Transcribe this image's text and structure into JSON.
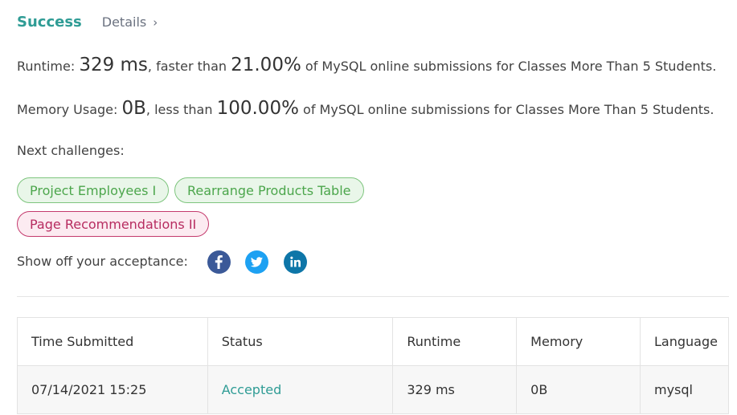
{
  "header": {
    "status": "Success",
    "details_label": "Details",
    "chevron": "›"
  },
  "runtime": {
    "label": "Runtime:",
    "value": "329 ms",
    "mid": ", faster than",
    "percent": "21.00%",
    "suffix": "of MySQL online submissions for Classes More Than 5 Students."
  },
  "memory": {
    "label": "Memory Usage:",
    "value": "0B",
    "mid": ", less than",
    "percent": "100.00%",
    "suffix": "of MySQL online submissions for Classes More Than 5 Students."
  },
  "next": {
    "label": "Next challenges:",
    "challenges": [
      {
        "title": "Project Employees I",
        "difficulty": "easy"
      },
      {
        "title": "Rearrange Products Table",
        "difficulty": "easy"
      },
      {
        "title": "Page Recommendations II",
        "difficulty": "hard"
      }
    ]
  },
  "share": {
    "label": "Show off your acceptance:",
    "icons": [
      "facebook-icon",
      "twitter-icon",
      "linkedin-icon"
    ]
  },
  "table": {
    "headers": [
      "Time Submitted",
      "Status",
      "Runtime",
      "Memory",
      "Language"
    ],
    "rows": [
      {
        "time": "07/14/2021 15:25",
        "status": "Accepted",
        "runtime": "329 ms",
        "memory": "0B",
        "language": "mysql"
      }
    ]
  },
  "colors": {
    "accent": "#2f9c95",
    "easy_border": "#7ec57e",
    "hard_border": "#c43a6d",
    "facebook": "#3b5998",
    "twitter": "#1da1f2",
    "linkedin": "#0e76a8"
  }
}
